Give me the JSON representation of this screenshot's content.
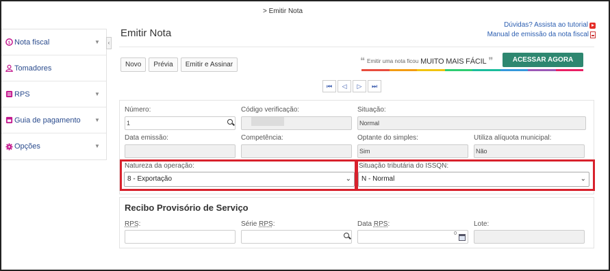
{
  "breadcrumb": "> Emitir Nota",
  "page_title": "Emitir Nota",
  "help": {
    "tutorial": "Dúvidas? Assista ao tutorial",
    "manual": "Manual de emissão da nota fiscal"
  },
  "sidebar": {
    "items": [
      {
        "label": "Nota fiscal",
        "icon": "dollar-circle-icon"
      },
      {
        "label": "Tomadores",
        "icon": "user-icon"
      },
      {
        "label": "RPS",
        "icon": "list-icon"
      },
      {
        "label": "Guia de pagamento",
        "icon": "receipt-icon"
      },
      {
        "label": "Opções",
        "icon": "gear-icon"
      }
    ],
    "collapse": "‹"
  },
  "toolbar": {
    "new": "Novo",
    "preview": "Prévia",
    "emit": "Emitir e Assinar"
  },
  "promo": {
    "open_quote": "❝",
    "text": "Emitir uma nota ficou",
    "highlight": "MUITO MAIS FÁCIL",
    "close_quote": "❞",
    "button": "ACESSAR AGORA",
    "bar_colors": [
      "#e84c3d",
      "#f39c12",
      "#f1c40f",
      "#2ecc71",
      "#1abc9c",
      "#3498db",
      "#9b59b6",
      "#e91e63"
    ]
  },
  "pager": {
    "first": "⏮",
    "prev": "◁",
    "next": "▷",
    "last": "⏭"
  },
  "form": {
    "numero_label": "Número:",
    "numero_value": "1",
    "codigo_label": "Código verificação:",
    "situacao_label": "Situação:",
    "situacao_value": "Normal",
    "data_emissao_label": "Data emissão:",
    "competencia_label": "Competência:",
    "optante_label": "Optante do simples:",
    "optante_value": "Sim",
    "aliquota_label": "Utiliza alíquota municipal:",
    "aliquota_value": "Não",
    "natureza_label": "Natureza da operação:",
    "natureza_value": "8 - Exportação",
    "situacao_trib_label": "Situação tributária do ISSQN:",
    "situacao_trib_value": "N - Normal"
  },
  "rps": {
    "title": "Recibo Provisório de Serviço",
    "rps_label_prefix": "RPS",
    "rps_label_suffix": ":",
    "serie_label_prefix": "Série ",
    "serie_label_mid": "RPS",
    "serie_label_suffix": ":",
    "data_label_prefix": "Data ",
    "data_label_mid": "RPS",
    "data_label_suffix": ":",
    "lote_label": "Lote:",
    "date_marker": "0"
  },
  "colors": {
    "link": "#2a5db0",
    "highlight_border": "#d8212c",
    "promo_button": "#2e8770"
  }
}
